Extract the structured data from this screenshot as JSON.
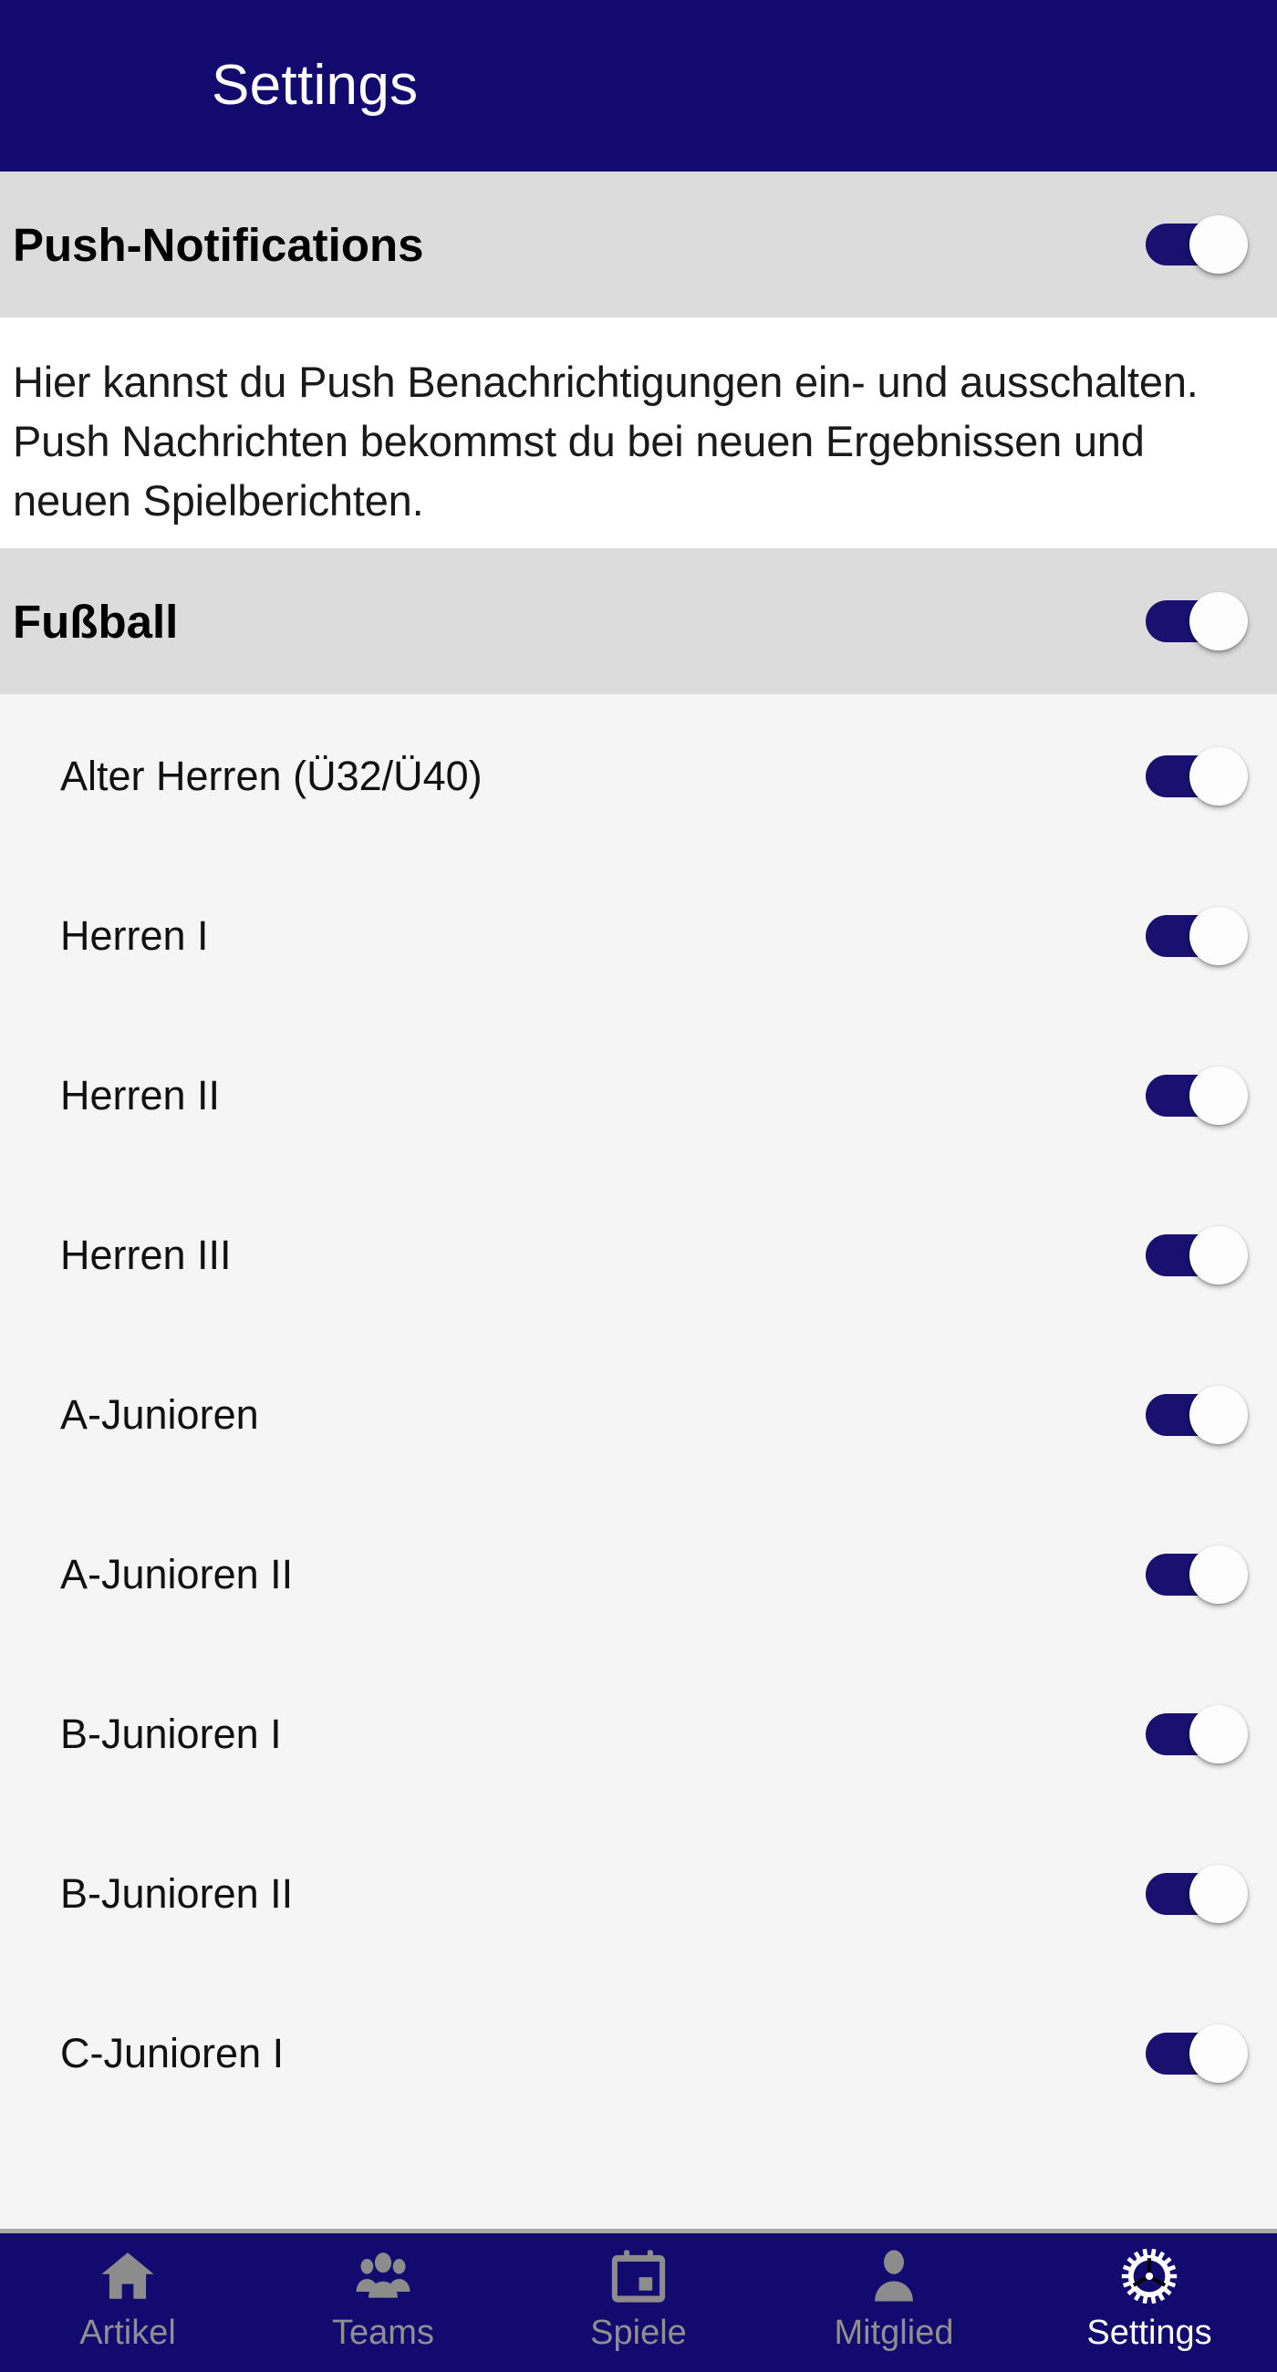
{
  "header": {
    "title": "Settings",
    "background": "#120a6e",
    "text_color": "#ffffff"
  },
  "colors": {
    "accent_navy": "#120a6e",
    "toggle_on_track": "#1a1070",
    "toggle_thumb": "#fdfdfd",
    "section_header_bg": "#dcdcdc",
    "list_bg": "#f5f5f5",
    "description_bg": "#ffffff",
    "nav_inactive": "#8c8c8c",
    "nav_active": "#ffffff"
  },
  "push_section": {
    "title": "Push-Notifications",
    "toggle": {
      "name": "push-notifications-toggle",
      "state": "on"
    },
    "description": "Hier kannst du Push Benachrichtigungen ein- und ausschalten. Push Nachrichten bekommst du bei neuen Ergebnissen und neuen Spielberichten."
  },
  "football_section": {
    "title": "Fußball",
    "toggle": {
      "name": "fussball-toggle",
      "state": "on"
    },
    "teams": [
      {
        "label": "Alter Herren (Ü32/Ü40)",
        "state": "on"
      },
      {
        "label": "Herren I",
        "state": "on"
      },
      {
        "label": "Herren II",
        "state": "on"
      },
      {
        "label": "Herren III",
        "state": "on"
      },
      {
        "label": "A-Junioren",
        "state": "on"
      },
      {
        "label": "A-Junioren II",
        "state": "on"
      },
      {
        "label": "B-Junioren I",
        "state": "on"
      },
      {
        "label": "B-Junioren II",
        "state": "on"
      },
      {
        "label": "C-Junioren I",
        "state": "on"
      }
    ]
  },
  "bottom_nav": {
    "items": [
      {
        "label": "Artikel",
        "icon": "home-icon",
        "active": false
      },
      {
        "label": "Teams",
        "icon": "people-icon",
        "active": false
      },
      {
        "label": "Spiele",
        "icon": "calendar-icon",
        "active": false
      },
      {
        "label": "Mitglied",
        "icon": "person-icon",
        "active": false
      },
      {
        "label": "Settings",
        "icon": "gear-icon",
        "active": true
      }
    ]
  }
}
